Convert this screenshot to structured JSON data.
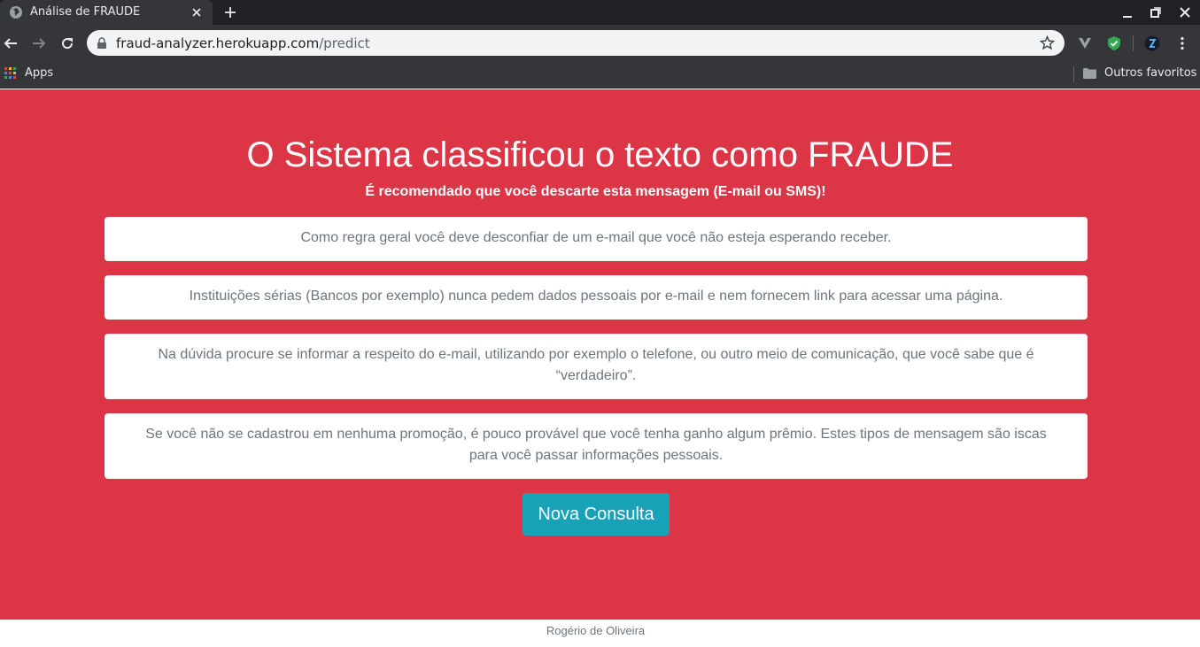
{
  "browser": {
    "tab_title": "Análise de FRAUDE",
    "url_host": "fraud-analyzer.herokuapp.com",
    "url_path": "/predict",
    "bookmarks": {
      "apps_label": "Apps",
      "other_label": "Outros favoritos"
    }
  },
  "result": {
    "headline": "O Sistema classificou o texto como FRAUDE",
    "recommendation": "É recomendado que você descarte esta mensagem (E-mail ou SMS)!",
    "tips": [
      "Como regra geral você deve desconfiar de um e-mail que você não esteja esperando receber.",
      "Instituições sérias (Bancos por exemplo) nunca pedem dados pessoais por e-mail e nem fornecem link para acessar uma página.",
      "Na dúvida procure se informar a respeito do e-mail, utilizando por exemplo o telefone, ou outro meio de comunicação, que você sabe que é “verdadeiro”.",
      "Se você não se cadastrou em nenhuma promoção, é pouco provável que você tenha ganho algum prêmio. Estes tipos de mensagem são iscas para você passar informações pessoais."
    ],
    "button_label": "Nova Consulta"
  },
  "footer": {
    "author": "Rogério de Oliveira"
  },
  "colors": {
    "danger_background": "#dc3545",
    "button": "#17a2b8",
    "card_text": "#6c757d"
  }
}
